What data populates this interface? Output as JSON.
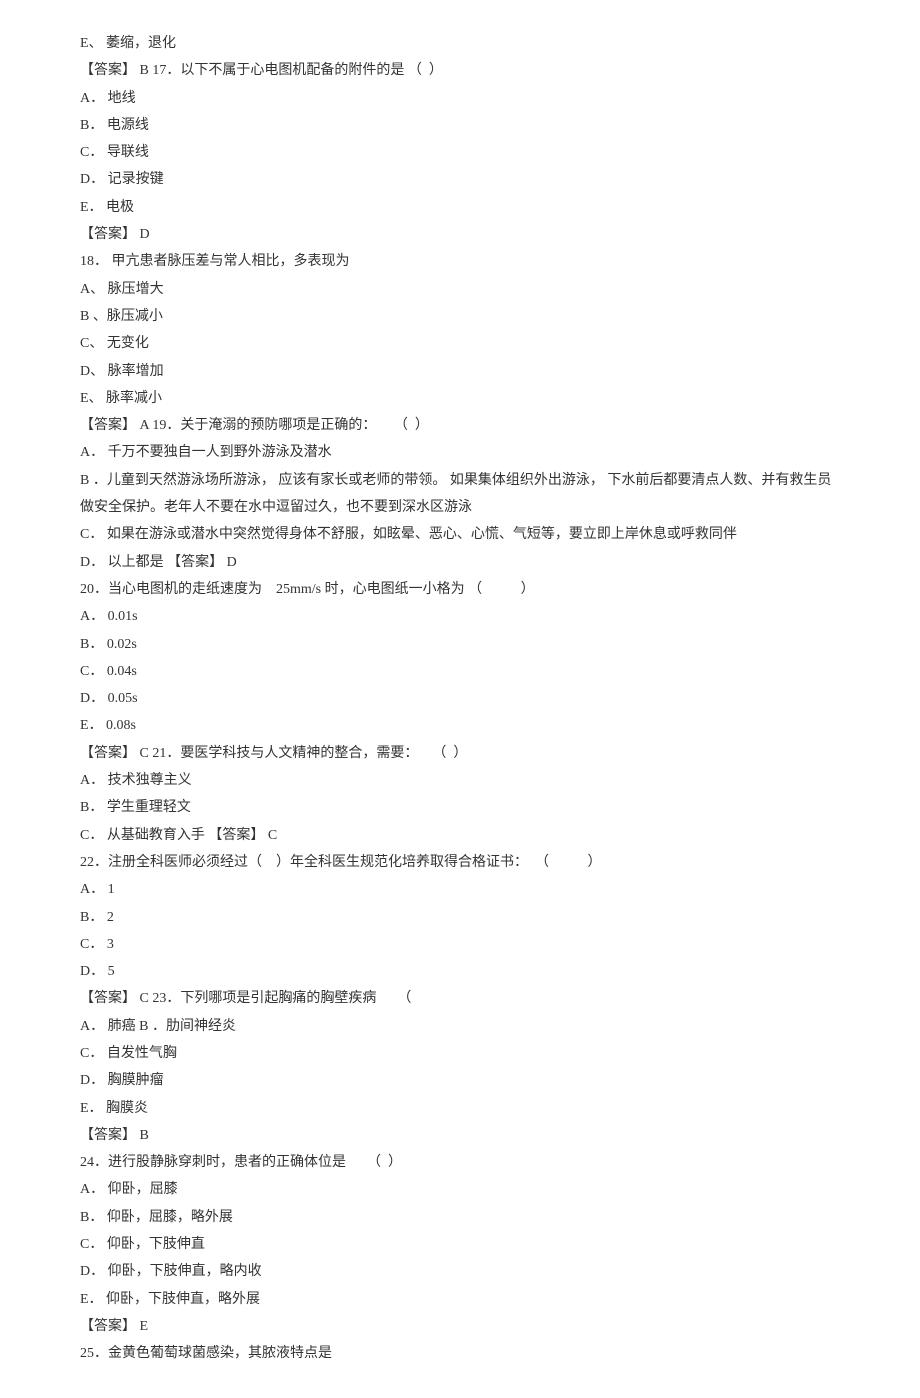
{
  "lines": [
    "E、 萎缩，退化",
    "【答案】 B 17．以下不属于心电图机配备的附件的是 （  ）",
    "A． 地线",
    "B． 电源线",
    "C． 导联线",
    "D． 记录按键",
    "E． 电极",
    "【答案】 D",
    "18． 甲亢患者脉压差与常人相比，多表现为",
    "A、 脉压增大",
    "B 、脉压减小",
    "C、 无变化",
    "D、 脉率增加",
    "E、 脉率减小",
    "【答案】 A 19．关于淹溺的预防哪项是正确的：     （  ）",
    "A． 千万不要独自一人到野外游泳及潜水",
    "B ．儿童到天然游泳场所游泳， 应该有家长或老师的带领。 如果集体组织外出游泳， 下水前后都要清点人数、并有救生员做安全保护。老年人不要在水中逗留过久，也不要到深水区游泳",
    "C． 如果在游泳或潜水中突然觉得身体不舒服，如眩晕、恶心、心慌、气短等，要立即上岸休息或呼救同伴",
    "D． 以上都是 【答案】 D",
    "20．当心电图机的走纸速度为    25mm/s 时，心电图纸一小格为 （           ）",
    "A． 0.01s",
    "B． 0.02s",
    "C． 0.04s",
    "D． 0.05s",
    "E． 0.08s",
    "【答案】 C 21．要医学科技与人文精神的整合，需要：    （  ）",
    "A． 技术独尊主义",
    "B． 学生重理轻文",
    "C． 从基础教育入手 【答案】 C",
    "22．注册全科医师必须经过（    ）年全科医生规范化培养取得合格证书：  （           ）",
    "A． 1",
    "B． 2",
    "C． 3",
    "D． 5",
    "【答案】 C 23．下列哪项是引起胸痛的胸壁疾病      （",
    "A． 肺癌 B ．肋间神经炎",
    "C． 自发性气胸",
    "D． 胸膜肿瘤",
    "E． 胸膜炎",
    "【答案】 B",
    "24．进行股静脉穿刺时，患者的正确体位是      （  ）",
    "A． 仰卧，屈膝",
    "B． 仰卧，屈膝，略外展",
    "C． 仰卧，下肢伸直",
    "D． 仰卧，下肢伸直，略内收",
    "E． 仰卧，下肢伸直，略外展",
    "【答案】 E",
    "25．金黄色葡萄球菌感染，其脓液特点是"
  ]
}
